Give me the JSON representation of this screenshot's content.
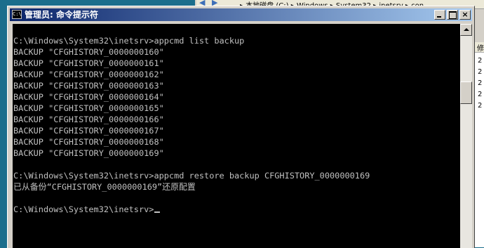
{
  "background_window": {
    "breadcrumb": "▸ 本地磁盘 (C:) ▸ Windows ▸ System32 ▸ inetsrv ▸ con",
    "column_header": "修",
    "rows": [
      "2",
      "2",
      "2",
      "2",
      "2"
    ]
  },
  "window": {
    "title": "管理员: 命令提示符",
    "icon_label": "C:\\",
    "minimize_label": "",
    "maximize_label": "",
    "close_label": "×"
  },
  "console": {
    "lines": [
      "",
      "C:\\Windows\\System32\\inetsrv>appcmd list backup",
      "BACKUP \"CFGHISTORY_0000000160\"",
      "BACKUP \"CFGHISTORY_0000000161\"",
      "BACKUP \"CFGHISTORY_0000000162\"",
      "BACKUP \"CFGHISTORY_0000000163\"",
      "BACKUP \"CFGHISTORY_0000000164\"",
      "BACKUP \"CFGHISTORY_0000000165\"",
      "BACKUP \"CFGHISTORY_0000000166\"",
      "BACKUP \"CFGHISTORY_0000000167\"",
      "BACKUP \"CFGHISTORY_0000000168\"",
      "BACKUP \"CFGHISTORY_0000000169\"",
      "",
      "C:\\Windows\\System32\\inetsrv>appcmd restore backup CFGHISTORY_0000000169",
      "已从备份“CFGHISTORY_0000000169”还原配置",
      "",
      "C:\\Windows\\System32\\inetsrv>"
    ]
  },
  "colors": {
    "console_bg": "#000000",
    "console_text": "#c0c0c0",
    "title_bar_start": "#0a246a",
    "title_bar_end": "#a6caf0",
    "desktop": "#1b6e8c"
  }
}
